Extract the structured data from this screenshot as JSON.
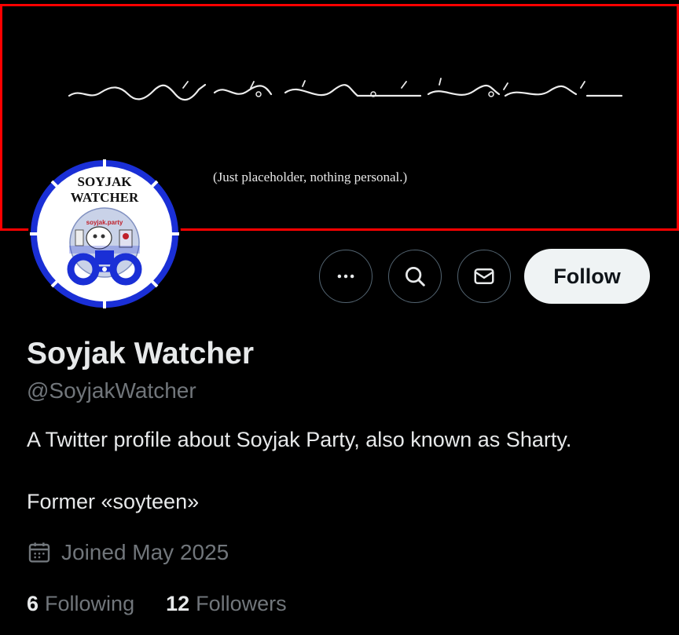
{
  "banner": {
    "caption": "(Just placeholder, nothing personal.)"
  },
  "avatar": {
    "logo_line1": "SOYJAK",
    "logo_line2": "WATCHER",
    "badge_text": "soyjak.party",
    "accent_color": "#1a2fd6"
  },
  "actions": {
    "more_icon": "more-icon",
    "search_icon": "search-icon",
    "message_icon": "mail-icon",
    "follow_label": "Follow"
  },
  "profile": {
    "display_name": "Soyjak Watcher",
    "handle": "@SoyjakWatcher",
    "bio_line1": "A Twitter profile about Soyjak Party, also known as Sharty.",
    "bio_line2": "Former «soyteen»",
    "joined": "Joined May 2025",
    "following_count": "6",
    "following_label": "Following",
    "followers_count": "12",
    "followers_label": "Followers"
  },
  "colors": {
    "background": "#000000",
    "text_primary": "#e7e9ea",
    "text_secondary": "#71767b",
    "banner_border": "#ff0000",
    "follow_button_bg": "#eff3f4"
  }
}
